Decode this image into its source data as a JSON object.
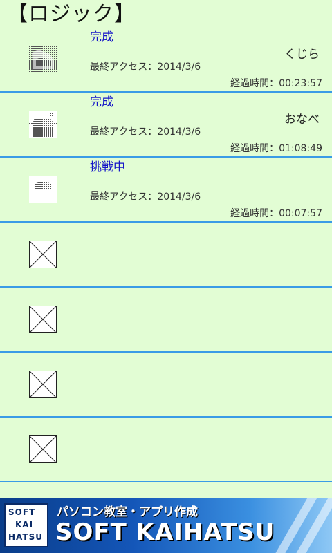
{
  "title": "【ロジック】",
  "items": [
    {
      "status": "完成",
      "name": "くじら",
      "last_access": "最終アクセス：2014/3/6",
      "elapsed": "経過時間：00:23:57",
      "thumb_icon": "whale-icon"
    },
    {
      "status": "完成",
      "name": "おなべ",
      "last_access": "最終アクセス：2014/3/6",
      "elapsed": "経過時間：01:08:49",
      "thumb_icon": "pot-icon"
    },
    {
      "status": "挑戦中",
      "name": "",
      "last_access": "最終アクセス：2014/3/6",
      "elapsed": "経過時間：00:07:57",
      "thumb_icon": "partial-puzzle-icon"
    },
    {
      "status": "",
      "name": "",
      "last_access": "",
      "elapsed": "",
      "thumb_icon": "empty-image-icon"
    },
    {
      "status": "",
      "name": "",
      "last_access": "",
      "elapsed": "",
      "thumb_icon": "empty-image-icon"
    },
    {
      "status": "",
      "name": "",
      "last_access": "",
      "elapsed": "",
      "thumb_icon": "empty-image-icon"
    },
    {
      "status": "",
      "name": "",
      "last_access": "",
      "elapsed": "",
      "thumb_icon": "empty-image-icon"
    }
  ],
  "banner": {
    "logo_lines": [
      "SOFT",
      "KAI",
      "HATSU"
    ],
    "tagline": "パソコン教室・アプリ作成",
    "brand": "SOFT KAIHATSU"
  },
  "colors": {
    "background": "#e2fdd4",
    "divider": "#3a9be6",
    "status": "#1414c8"
  }
}
